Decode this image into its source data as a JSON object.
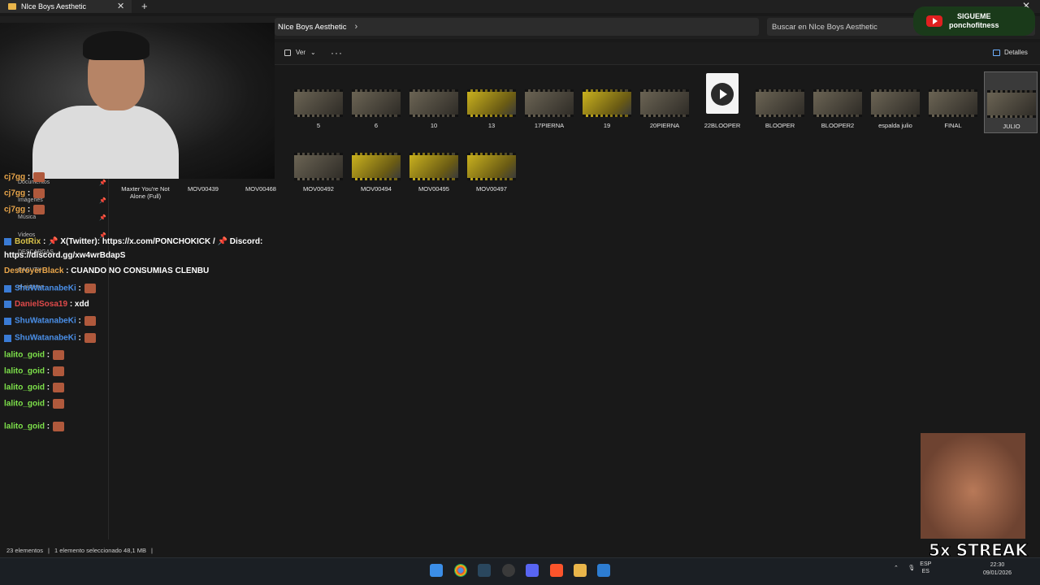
{
  "window": {
    "tab_title": "NIce Boys Aesthetic",
    "tab_close": "✕",
    "tab_add": "+",
    "close_glyph": "✕"
  },
  "address": {
    "path": "NIce Boys Aesthetic",
    "chevron": "›"
  },
  "search": {
    "placeholder": "Buscar en NIce Boys Aesthetic"
  },
  "toolbar": {
    "view_label": "Ver",
    "more_label": "···",
    "details_label": "Detalles"
  },
  "files_row1": [
    {
      "name": "5",
      "style": "gray"
    },
    {
      "name": "6",
      "style": "gray"
    },
    {
      "name": "10",
      "style": "gray"
    },
    {
      "name": "13",
      "style": "yellow"
    },
    {
      "name": "17PIERNA",
      "style": "gray"
    },
    {
      "name": "19",
      "style": "yellow"
    },
    {
      "name": "20PIERNA",
      "style": "gray"
    },
    {
      "name": "22BLOOPER",
      "style": "doc"
    },
    {
      "name": "BLOOPER",
      "style": "gray"
    },
    {
      "name": "BLOOPER2",
      "style": "gray"
    },
    {
      "name": "espalda julio",
      "style": "gray"
    },
    {
      "name": "FINAL",
      "style": "gray"
    },
    {
      "name": "JULIO",
      "style": "gray",
      "selected": true
    }
  ],
  "files_row2": [
    {
      "name": "Maxter  You're Not Alone (Full)",
      "style": "none"
    },
    {
      "name": "MOV00439",
      "style": "none"
    },
    {
      "name": "MOV00468",
      "style": "none"
    },
    {
      "name": "MOV00492",
      "style": "gray"
    },
    {
      "name": "MOV00494",
      "style": "yellow"
    },
    {
      "name": "MOV00495",
      "style": "yellow"
    },
    {
      "name": "MOV00497",
      "style": "yellow"
    }
  ],
  "sidebar": {
    "items": [
      "Documentos",
      "Imágenes",
      "Música",
      "Videos",
      "DESCARGAS",
      "CACUTX",
      "el sistema"
    ]
  },
  "chat": [
    {
      "user": "cj7gg",
      "text": ":",
      "color": "orange"
    },
    {
      "user": "cj7gg",
      "text": ":",
      "color": "orange"
    },
    {
      "user": "cj7gg",
      "text": ":",
      "color": "orange"
    },
    {
      "user": "BotRix",
      "text": ": 📌 X(Twitter): https://x.com/PONCHOKICK / 📌 Discord:",
      "color": "olive"
    },
    {
      "user": "",
      "text": "https://discord.gg/xw4wrBdapS",
      "color": "white"
    },
    {
      "user": "DestroyerBlack",
      "text": ": CUANDO NO CONSUMIAS CLENBU",
      "color": "orange"
    },
    {
      "user": "ShuWatanabeKi",
      "text": ":",
      "color": "blue"
    },
    {
      "user": "DanielSosa19",
      "text": ": xdd",
      "color": "red"
    },
    {
      "user": "ShuWatanabeKi",
      "text": ":",
      "color": "blue"
    },
    {
      "user": "ShuWatanabeKi",
      "text": ":",
      "color": "blue"
    },
    {
      "user": "lalito_goid",
      "text": ":",
      "color": "green"
    },
    {
      "user": "lalito_goid",
      "text": ":",
      "color": "green"
    },
    {
      "user": "lalito_goid",
      "text": ":",
      "color": "green"
    },
    {
      "user": "lalito_goid",
      "text": ":",
      "color": "green"
    },
    {
      "user": "lalito_goid",
      "text": ":",
      "color": "green"
    }
  ],
  "subscribe": {
    "line1": "SIGUEME",
    "line2": "ponchofitness"
  },
  "streak": {
    "text": "5x STREAK"
  },
  "status": {
    "count": "23 elementos",
    "selection": "1 elemento seleccionado  48,1 MB"
  },
  "tray": {
    "lang1": "ESP",
    "lang2": "ES",
    "time": "22:30",
    "date": "09/01/2026"
  },
  "colors": {
    "accent": "#6fb1ff",
    "folder": "#e9b54a"
  }
}
